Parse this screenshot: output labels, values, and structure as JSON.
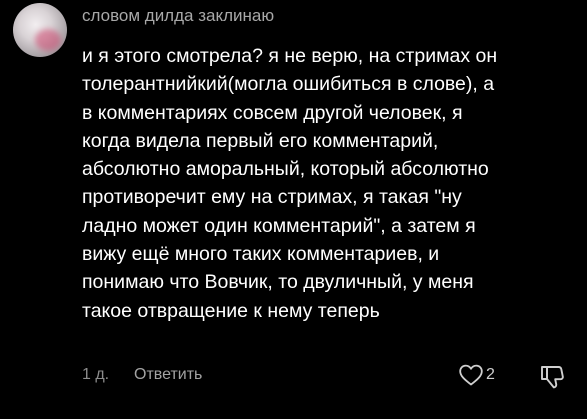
{
  "comment": {
    "username": "словом дилда заклинаю",
    "text_lines": [
      "и я этого смотрела? я не верю, на стримах он",
      "толерантнийкий(могла ошибиться в слове), а",
      "в комментариях совсем другой человек, я",
      "когда видела первый его комментарий,",
      "абсолютно аморальный, который абсолютно",
      "противоречит ему на стримах, я такая \"ну",
      "ладно может один комментарий\", а затем я",
      "вижу ещё много таких комментариев, и",
      "понимаю что Вовчик, то двуличный, у меня",
      "такое отвращение к нему теперь"
    ],
    "time": "1 д.",
    "reply_label": "Ответить",
    "like_count": "2",
    "icons": {
      "like": "heart-outline-icon",
      "dislike": "thumbs-down-icon"
    },
    "colors": {
      "background": "#000000",
      "text": "#ffffff",
      "username": "#a8a8a8",
      "meta": "#8c8c8c"
    }
  }
}
